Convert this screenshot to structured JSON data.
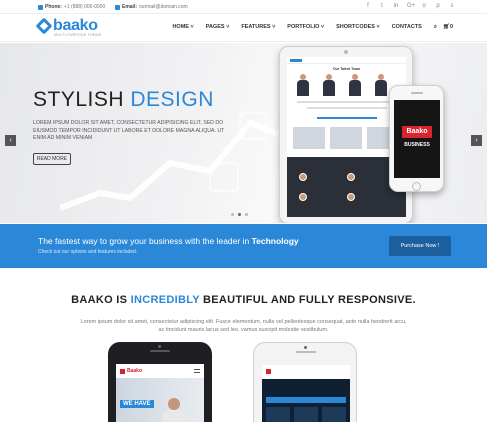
{
  "topbar": {
    "phone_label": "Phone:",
    "phone": "+1 (888) 000-0000",
    "email_label": "Email:",
    "email": "ourmail@domain.com",
    "social_icons": [
      "facebook-icon",
      "twitter-icon",
      "linkedin-icon",
      "google-plus-icon",
      "github-icon",
      "pinterest-icon",
      "skype-icon"
    ],
    "social_glyphs": [
      "f",
      "t",
      "in",
      "G+",
      "o",
      "p",
      "s"
    ]
  },
  "header": {
    "logo": "baako",
    "tagline": "MULTI-PURPOSE THEME",
    "nav": [
      "HOME",
      "PAGES",
      "FEATURES",
      "PORTFOLIO",
      "SHORTCODES",
      "CONTACTS"
    ],
    "cart_count": "0"
  },
  "hero": {
    "title_part1": "STYLISH",
    "title_part2": "DESIGN",
    "text": "LOREM IPSUM DOLOR SIT AMET, CONSECTETUR ADIPISICING ELIT, SED DO EIUSMOD TEMPOR INCIDIDUNT UT LABORE ET DOLORE MAGNA ALIQUA. UT ENIM AD MINIM VENIAM",
    "button": "READ MORE",
    "prev": "‹",
    "next": "›",
    "slide_count": 3,
    "active_slide": 1,
    "device_brand": "Baako",
    "device_brand_sub": "BUSINESS",
    "tablet_title": "Our Talent Team"
  },
  "strip": {
    "headline_prefix": "The fastest way to grow your business with the leader in",
    "headline_bold": "Technology",
    "subtext": "Check out our options and features included.",
    "button": "Purchase Now !"
  },
  "section": {
    "title_part1": "BAAKO IS",
    "title_accent": "INCREDIBLY",
    "title_part2": "BEAUTIFUL AND FULLY RESPONSIVE.",
    "text": "Lorem ipsum dolor sit amet, consectetur adipiscing elit. Fusce elementum, nulla vel pellentesque consequat, ante nulla hendrerit arcu, ac tincidunt mauris lacus sed leo. vamus suscipit molestie vestibulum."
  },
  "bottom_phone": {
    "logo": "Baako",
    "hero_text": "WE HAVE"
  },
  "colors": {
    "accent": "#2b88d8",
    "brand_red": "#d9232d",
    "button_dark_blue": "#1b5f9e"
  }
}
